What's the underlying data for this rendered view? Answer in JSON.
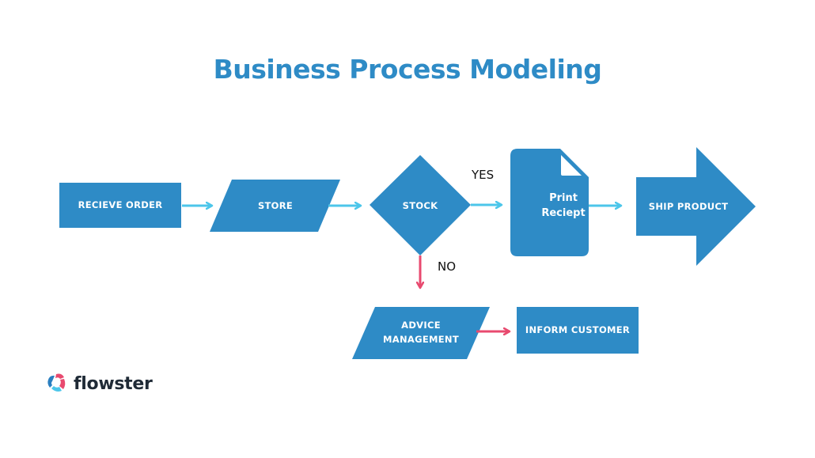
{
  "title": "Business Process Modeling",
  "colors": {
    "shape_fill": "#2e8bc6",
    "yes_flow_arrow": "#4cc6ea",
    "no_flow_arrow": "#e84a6f",
    "title": "#2e8bc6",
    "brand_text": "#1f2a36"
  },
  "nodes": {
    "receive_order": {
      "label": "RECIEVE ORDER",
      "shape": "rectangle"
    },
    "store": {
      "label": "STORE",
      "shape": "parallelogram"
    },
    "stock": {
      "label": "STOCK",
      "shape": "diamond"
    },
    "print_receipt": {
      "label_line1": "Print",
      "label_line2": "Reciept",
      "shape": "document"
    },
    "ship_product": {
      "label": "SHIP PRODUCT",
      "shape": "block-arrow"
    },
    "advice_management": {
      "label_line1": "ADVICE",
      "label_line2": "MANAGEMENT",
      "shape": "parallelogram"
    },
    "inform_customer": {
      "label": "INFORM CUSTOMER",
      "shape": "rectangle"
    }
  },
  "edges": [
    {
      "from": "receive_order",
      "to": "store",
      "label": ""
    },
    {
      "from": "store",
      "to": "stock",
      "label": ""
    },
    {
      "from": "stock",
      "to": "print_receipt",
      "label": "YES"
    },
    {
      "from": "print_receipt",
      "to": "ship_product",
      "label": ""
    },
    {
      "from": "stock",
      "to": "advice_management",
      "label": "NO"
    },
    {
      "from": "advice_management",
      "to": "inform_customer",
      "label": ""
    }
  ],
  "branch_labels": {
    "yes": "YES",
    "no": "NO"
  },
  "brand": {
    "name": "flowster",
    "icon": "flowster-logo-icon"
  }
}
